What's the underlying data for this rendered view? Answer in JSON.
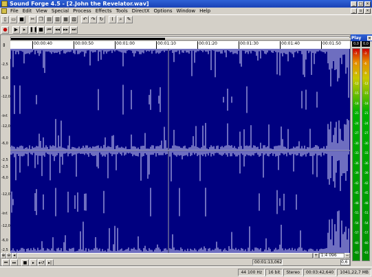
{
  "window": {
    "title": "Sound Forge 4.5 - [2.John the Revelator.wav]"
  },
  "menu": [
    "File",
    "Edit",
    "View",
    "Special",
    "Process",
    "Effects",
    "Tools",
    "DirectX",
    "Options",
    "Window",
    "Help"
  ],
  "time_ruler": [
    "00:00:40",
    "00:00:50",
    "00:01:00",
    "00:01:10",
    "00:01:20",
    "00:01:30",
    "00:01:40",
    "00:01:50"
  ],
  "db_scale": [
    "-2,5",
    "-6,0",
    "-12,0",
    "-Inf.",
    "-12,0",
    "-6,0",
    "-2,5",
    "-2,5",
    "-6,0",
    "-12,0",
    "-Inf.",
    "-12,0",
    "-6,0",
    "-2,5"
  ],
  "zoom_ratio": "1:4 096",
  "cursor_position": "00:01:13,062",
  "selection_length": "0,6",
  "play_meter": {
    "title": "Play",
    "peaks": [
      "0,0",
      "0,0"
    ],
    "scale": [
      "-3",
      "-6",
      "-9",
      "-12",
      "-15",
      "-18",
      "-21",
      "-24",
      "-27",
      "-30",
      "-33",
      "-36",
      "-39",
      "-42",
      "-45",
      "-48",
      "-51",
      "-54",
      "-57",
      "-60",
      "-63"
    ]
  },
  "status": {
    "sample_rate": "44 100 Hz",
    "bit_depth": "16 bit",
    "channels": "Stereo",
    "length": "00:03:42,640",
    "free_space": "1041,22,7 MB"
  },
  "colors": {
    "waveform_bg": "#000080",
    "waveform_fg": "#ffffff",
    "titlebar": "#1942b6"
  }
}
